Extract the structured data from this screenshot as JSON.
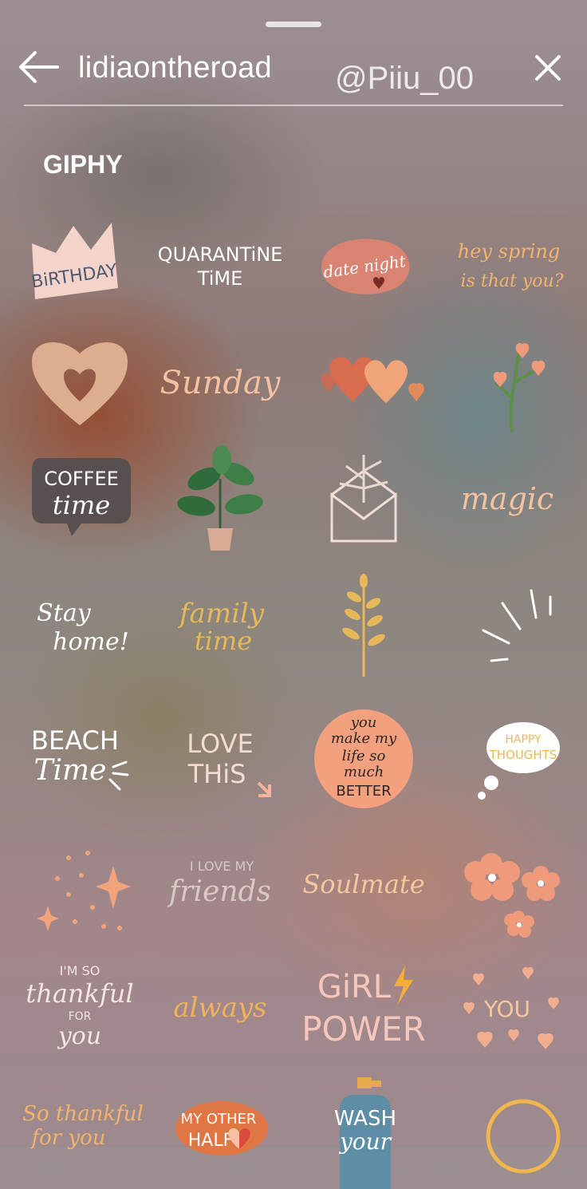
{
  "header": {
    "search_value": "lidiaontheroad",
    "watermark": "@Piiu_00",
    "back_icon": "arrow-left-icon",
    "close_icon": "close-icon"
  },
  "section_title": "GIPHY",
  "stickers": [
    {
      "name": "sticker-birthday-crown",
      "text": [
        "BiRTHDAY"
      ]
    },
    {
      "name": "sticker-quarantine-time",
      "text": [
        "QUARANTiNE",
        "TiME"
      ]
    },
    {
      "name": "sticker-date-night",
      "text": [
        "date night"
      ]
    },
    {
      "name": "sticker-hey-spring",
      "text": [
        "hey spring",
        "is that you?"
      ]
    },
    {
      "name": "sticker-heart-outline",
      "text": []
    },
    {
      "name": "sticker-sunday",
      "text": [
        "Sunday"
      ]
    },
    {
      "name": "sticker-hearts-row",
      "text": []
    },
    {
      "name": "sticker-flower-branch",
      "text": []
    },
    {
      "name": "sticker-coffee-time",
      "text": [
        "COFFEE",
        "time"
      ]
    },
    {
      "name": "sticker-potted-plant",
      "text": []
    },
    {
      "name": "sticker-envelope-plant",
      "text": []
    },
    {
      "name": "sticker-magic",
      "text": [
        "magic"
      ]
    },
    {
      "name": "sticker-stay-home",
      "text": [
        "Stay",
        "home!"
      ]
    },
    {
      "name": "sticker-family-time",
      "text": [
        "family",
        "time"
      ]
    },
    {
      "name": "sticker-leaf-branch",
      "text": []
    },
    {
      "name": "sticker-sparkle-lines",
      "text": []
    },
    {
      "name": "sticker-beach-time",
      "text": [
        "BEACH",
        "Time"
      ]
    },
    {
      "name": "sticker-love-this",
      "text": [
        "LOVE",
        "THiS"
      ]
    },
    {
      "name": "sticker-you-make-my-life",
      "text": [
        "you",
        "make my",
        "life so",
        "much",
        "BETTER"
      ]
    },
    {
      "name": "sticker-happy-thoughts",
      "text": [
        "HAPPY",
        "THOUGHTS"
      ]
    },
    {
      "name": "sticker-stars",
      "text": []
    },
    {
      "name": "sticker-i-love-my-friends",
      "text": [
        "I LOVE MY",
        "friends"
      ]
    },
    {
      "name": "sticker-soulmate",
      "text": [
        "Soulmate"
      ]
    },
    {
      "name": "sticker-flowers",
      "text": []
    },
    {
      "name": "sticker-im-so-thankful",
      "text": [
        "I'M SO",
        "thankful",
        "FOR",
        "you"
      ]
    },
    {
      "name": "sticker-always",
      "text": [
        "always"
      ]
    },
    {
      "name": "sticker-girl-power",
      "text": [
        "GiRL",
        "POWER"
      ]
    },
    {
      "name": "sticker-you-hearts",
      "text": [
        "YOU"
      ]
    },
    {
      "name": "sticker-so-thankful-for-you",
      "text": [
        "So thankful",
        "for you"
      ]
    },
    {
      "name": "sticker-my-other-half",
      "text": [
        "MY OTHER",
        "HALF"
      ]
    },
    {
      "name": "sticker-wash-your-hands",
      "text": [
        "WASH",
        "your"
      ]
    },
    {
      "name": "sticker-circle",
      "text": []
    }
  ],
  "colors": {
    "white": "#ffffff",
    "peach": "#f3b08f",
    "pink": "#f1c7bf",
    "terracotta": "#d56b4f",
    "mustard": "#e7b85a",
    "green": "#5e8f4a",
    "dark": "#5a5556",
    "blue": "#5d8ea6"
  }
}
